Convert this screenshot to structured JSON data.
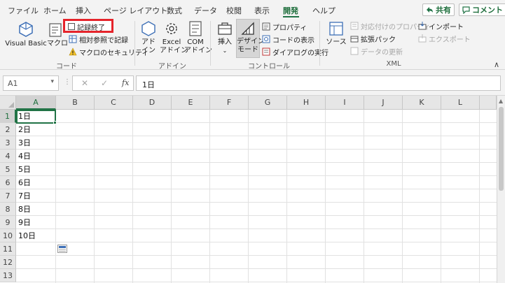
{
  "tabs": [
    "ファイル",
    "ホーム",
    "挿入",
    "ページ レイアウト",
    "数式",
    "データ",
    "校閲",
    "表示",
    "開発",
    "ヘルプ"
  ],
  "active_tab": "開発",
  "header_buttons": {
    "share": "共有",
    "comment": "コメント"
  },
  "ribbon": {
    "code": {
      "visual_basic": "Visual Basic",
      "macro": "マクロ",
      "record_stop": "記録終了",
      "relative": "相対参照で記録",
      "security": "マクロのセキュリティ",
      "label": "コード"
    },
    "addins": {
      "addin_line1": "アド",
      "addin_line2": "イン",
      "excel_line1": "Excel",
      "excel_line2": "アドイン",
      "com_line1": "COM",
      "com_line2": "アドイン",
      "label": "アドイン"
    },
    "controls": {
      "insert": "挿入",
      "design_line1": "デザイン",
      "design_line2": "モード",
      "properties": "プロパティ",
      "view_code": "コードの表示",
      "run_dialog": "ダイアログの実行",
      "label": "コントロール"
    },
    "xml": {
      "source": "ソース",
      "map_properties": "対応付けのプロパティ",
      "expansion": "拡張パック",
      "refresh": "データの更新",
      "import": "インポート",
      "export": "エクスポート",
      "label": "XML"
    }
  },
  "formula_bar": {
    "name_box": "A1",
    "fx": "fx",
    "value": "1日"
  },
  "columns": [
    "A",
    "B",
    "C",
    "D",
    "E",
    "F",
    "G",
    "H",
    "I",
    "J",
    "K",
    "L"
  ],
  "rows": [
    "1",
    "2",
    "3",
    "4",
    "5",
    "6",
    "7",
    "8",
    "9",
    "10",
    "11",
    "12",
    "13"
  ],
  "cells_a": [
    "1日",
    "2日",
    "3日",
    "4日",
    "5日",
    "6日",
    "7日",
    "8日",
    "9日",
    "10日"
  ],
  "colors": {
    "accent": "#217346",
    "highlight": "#e5242b"
  }
}
